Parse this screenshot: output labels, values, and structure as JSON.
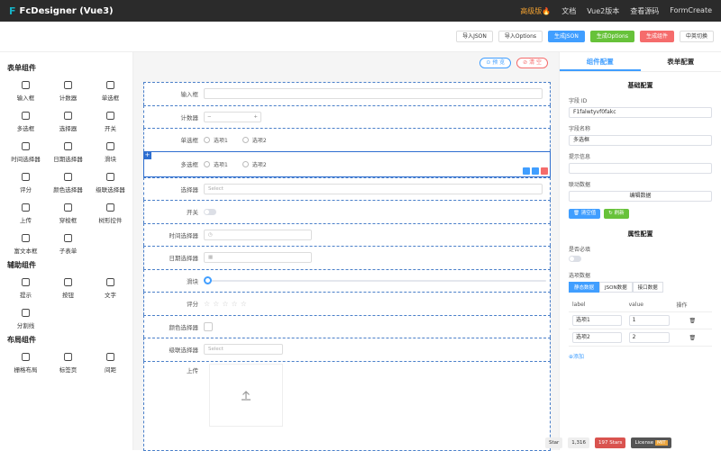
{
  "app": {
    "title": "FcDesigner (Vue3)"
  },
  "nav": {
    "pro": "高级版🔥",
    "docs": "文档",
    "vue2": "Vue2版本",
    "source": "查看源码",
    "formcreate": "FormCreate"
  },
  "toolbar": {
    "import_json": "导入JSON",
    "import_options": "导入Options",
    "gen_json": "生成JSON",
    "gen_options": "生成Options",
    "gen_component": "生成组件",
    "lang": "中英切换"
  },
  "left": {
    "form_group": "表单组件",
    "form_items": [
      {
        "label": "输入框",
        "icon": "input-icon"
      },
      {
        "label": "计数器",
        "icon": "counter-icon"
      },
      {
        "label": "单选框",
        "icon": "radio-icon"
      },
      {
        "label": "多选框",
        "icon": "checkbox-icon"
      },
      {
        "label": "选择器",
        "icon": "select-icon"
      },
      {
        "label": "开关",
        "icon": "switch-icon"
      },
      {
        "label": "时间选择器",
        "icon": "clock-icon"
      },
      {
        "label": "日期选择器",
        "icon": "calendar-icon"
      },
      {
        "label": "滑块",
        "icon": "slider-icon"
      },
      {
        "label": "评分",
        "icon": "star-icon"
      },
      {
        "label": "颜色选择器",
        "icon": "palette-icon"
      },
      {
        "label": "级联选择器",
        "icon": "cascader-icon"
      },
      {
        "label": "上传",
        "icon": "upload-icon"
      },
      {
        "label": "穿梭框",
        "icon": "transfer-icon"
      },
      {
        "label": "树形控件",
        "icon": "tree-icon"
      },
      {
        "label": "富文本框",
        "icon": "richtext-icon"
      },
      {
        "label": "子表单",
        "icon": "subform-icon"
      }
    ],
    "aux_group": "辅助组件",
    "aux_items": [
      {
        "label": "提示",
        "icon": "alert-icon"
      },
      {
        "label": "按钮",
        "icon": "button-icon"
      },
      {
        "label": "文字",
        "icon": "text-icon"
      },
      {
        "label": "分割线",
        "icon": "divider-icon"
      }
    ],
    "layout_group": "布局组件",
    "layout_items": [
      {
        "label": "栅格布局",
        "icon": "grid-icon"
      },
      {
        "label": "标签页",
        "icon": "tabs-icon"
      },
      {
        "label": "间距",
        "icon": "space-icon"
      }
    ]
  },
  "canvas": {
    "preview": "⊙ 预 览",
    "clear": "⊘ 清 空",
    "fields": {
      "input": "输入框",
      "counter": "计数器",
      "radio": "单选框",
      "checkbox": "多选框",
      "select": "选择器",
      "switch": "开关",
      "time": "时间选择器",
      "date": "日期选择器",
      "slider": "滑块",
      "rate": "评分",
      "color": "颜色选择器",
      "cascader": "级联选择器",
      "upload": "上传"
    },
    "opt1": "选项1",
    "opt2": "选项2",
    "select_placeholder": "Select",
    "counter_minus": "−",
    "counter_plus": "+"
  },
  "right": {
    "tab_component": "组件配置",
    "tab_form": "表单配置",
    "basic": "基础配置",
    "field_id_label": "字段 ID",
    "field_id": "F1falwtyvf0fakc",
    "field_name_label": "字段名称",
    "field_name": "多选框",
    "hint_label": "提示信息",
    "link_label": "联动数据",
    "edit_data": "编辑数据",
    "clear_btn": "清空值",
    "refresh_btn": "刷新",
    "attr": "属性配置",
    "required_label": "是否必填",
    "options_label": "选项数据",
    "seg_static": "静态数据",
    "seg_json": "JSON数据",
    "seg_api": "接口数据",
    "th_label": "label",
    "th_value": "value",
    "th_op": "操作",
    "rows": [
      {
        "label": "选项1",
        "value": "1"
      },
      {
        "label": "选项2",
        "value": "2"
      }
    ],
    "add": "添加"
  },
  "badges": {
    "star": "Star",
    "star_count": "1,316",
    "stars197": "197 Stars",
    "license": "License",
    "mit": "MIT"
  },
  "colors": {
    "accent": "#409eff",
    "green": "#67c23a",
    "red": "#f56c6c",
    "topbar": "#2b2b2b",
    "drag": "#2f6fd0"
  }
}
